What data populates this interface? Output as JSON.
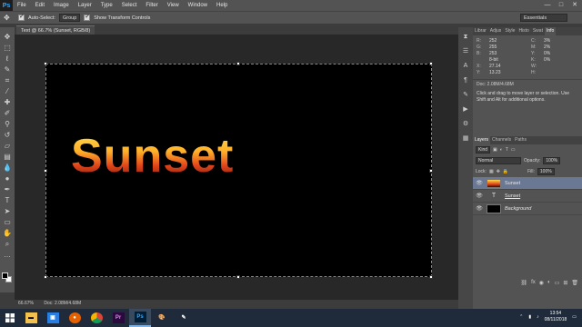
{
  "app": {
    "logo": "Ps"
  },
  "menu": [
    "File",
    "Edit",
    "Image",
    "Layer",
    "Type",
    "Select",
    "Filter",
    "View",
    "Window",
    "Help"
  ],
  "window_controls": [
    "—",
    "□",
    "✕"
  ],
  "options": {
    "auto_select_label": "Auto-Select:",
    "auto_select_value": "Group",
    "transform_label": "Show Transform Controls",
    "workspace": "Essentials"
  },
  "document": {
    "tab_title": "Text @ 66.7% (Sunset, RGB/8)",
    "text": "Sunset"
  },
  "status": {
    "zoom": "66.67%",
    "doc": "Doc: 2.08M/4.68M"
  },
  "info_panel": {
    "tabs": [
      "Librar",
      "Adjus",
      "Style",
      "Histo",
      "Swat",
      "Info"
    ],
    "active_tab": "Info",
    "rows": [
      {
        "l": "R:",
        "v": "252"
      },
      {
        "l": "C:",
        "v": "3%"
      },
      {
        "l": "G:",
        "v": "255"
      },
      {
        "l": "M:",
        "v": "2%"
      },
      {
        "l": "B:",
        "v": "253"
      },
      {
        "l": "Y:",
        "v": "0%"
      },
      {
        "l": "",
        "v": "8-bit"
      },
      {
        "l": "K:",
        "v": "0%"
      },
      {
        "l": "X:",
        "v": "27.14"
      },
      {
        "l": "W:",
        "v": ""
      },
      {
        "l": "Y:",
        "v": "13.23"
      },
      {
        "l": "H:",
        "v": ""
      }
    ],
    "doc_size": "Doc: 2.08M/4.68M",
    "help": "Click and drag to move layer or selection. Use Shift and Alt for additional options."
  },
  "layers_panel": {
    "tabs": [
      "Layers",
      "Channels",
      "Paths"
    ],
    "kind_label": "Kind",
    "blend_mode": "Normal",
    "opacity_label": "Opacity:",
    "opacity_value": "100%",
    "lock_label": "Lock:",
    "fill_label": "Fill:",
    "fill_value": "100%",
    "layers": [
      {
        "name": "Sunset",
        "thumb": "img",
        "selected": true
      },
      {
        "name": "Sunset",
        "thumb": "txt",
        "selected": false
      },
      {
        "name": "Background",
        "thumb": "bg",
        "selected": false
      }
    ],
    "footer_icons": [
      "link-icon",
      "fx-icon",
      "mask-icon",
      "adjustment-icon",
      "folder-icon",
      "new-layer-icon",
      "trash-icon"
    ]
  },
  "taskbar": {
    "apps": [
      "start",
      "file-explorer",
      "store",
      "firefox",
      "chrome",
      "premiere",
      "photoshop",
      "paint",
      "pen"
    ],
    "time": "13:54",
    "date": "08/11/2018"
  }
}
